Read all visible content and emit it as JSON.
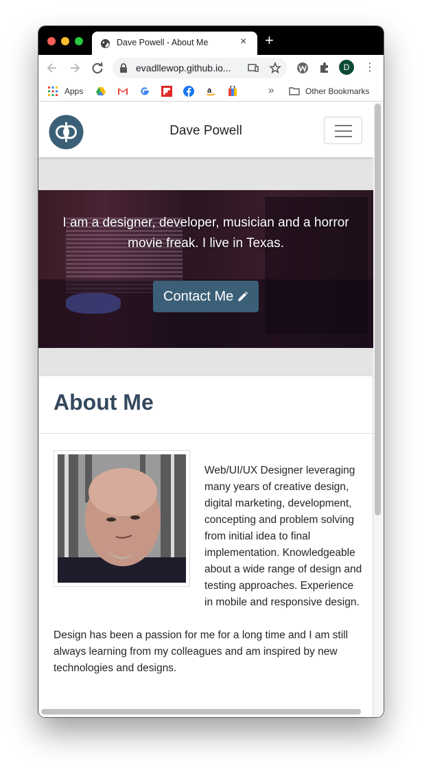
{
  "browser": {
    "tab_title": "Dave Powell - About Me",
    "tab_close": "×",
    "new_tab": "+",
    "url": "evadllewop.github.io...",
    "profile_initial": "D",
    "menu_glyph": "⋮",
    "bookmarks": {
      "apps_label": "Apps",
      "overflow": "»",
      "other_label": "Other Bookmarks"
    }
  },
  "site": {
    "name": "Dave Powell",
    "hero": {
      "text": "I am a designer, developer, musician and a horror movie freak. I live in Texas.",
      "button_label": "Contact Me"
    },
    "about": {
      "title": "About Me",
      "paragraphs": [
        "Web/UI/UX Designer leveraging many years of creative design, digital marketing, development, concepting and problem solving from initial idea to final implementation. Knowledgeable about a wide range of design and testing approaches. Experience in mobile and responsive design.",
        "Design has been a passion for me for a long time and I am still always learning from my colleagues and am inspired by new technologies and designs."
      ]
    }
  },
  "colors": {
    "heading": "#34495e",
    "button": "#3c5f78",
    "logo": "#3c5f78"
  },
  "icons": [
    "globe-icon",
    "back-icon",
    "forward-icon",
    "reload-icon",
    "lock-icon",
    "cast-icon",
    "star-icon",
    "extension-icon",
    "puzzle-icon",
    "folder-icon",
    "logo-icon",
    "hamburger-icon",
    "pencil-icon"
  ]
}
